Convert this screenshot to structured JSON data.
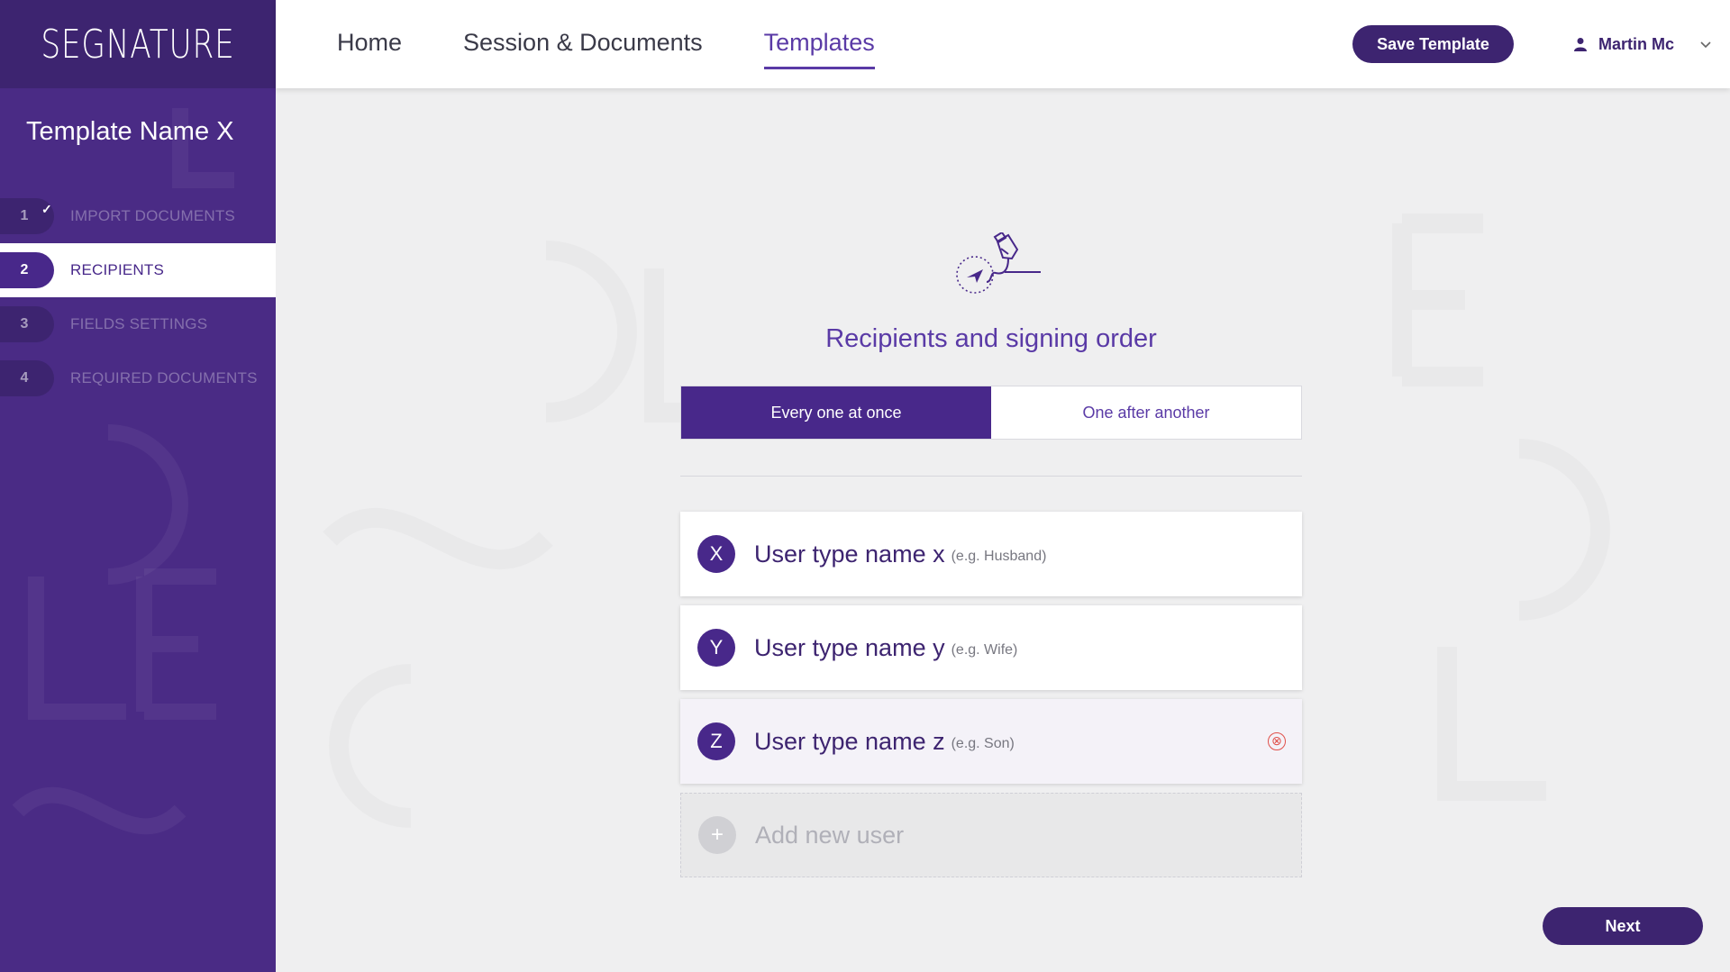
{
  "brand": {
    "logo_text": "SEGNATURE"
  },
  "header": {
    "nav": [
      {
        "label": "Home",
        "active": false
      },
      {
        "label": "Session & Documents",
        "active": false
      },
      {
        "label": "Templates",
        "active": true
      }
    ],
    "save_label": "Save Template",
    "user_name": "Martin Mc",
    "user_icon": "person-icon",
    "dropdown_icon": "chevron-down-icon"
  },
  "sidebar": {
    "template_name": "Template Name X",
    "steps": [
      {
        "number": "1",
        "label": "IMPORT DOCUMENTS",
        "completed": true,
        "check": "✓"
      },
      {
        "number": "2",
        "label": "RECIPIENTS",
        "active": true
      },
      {
        "number": "3",
        "label": "FIELDS SETTINGS"
      },
      {
        "number": "4",
        "label": "REQUIRED DOCUMENTS"
      }
    ]
  },
  "main": {
    "title": "Recipients and signing order",
    "hero_icon": "signing-pen-icon",
    "order_options": [
      {
        "label": "Every one at once",
        "active": true
      },
      {
        "label": "One after another",
        "active": false
      }
    ],
    "users": [
      {
        "letter": "X",
        "name": "User type name x",
        "hint": "(e.g. Husband)"
      },
      {
        "letter": "Y",
        "name": "User type name y",
        "hint": "(e.g. Wife)"
      },
      {
        "letter": "Z",
        "name": "User type name z",
        "hint": "(e.g. Son)",
        "remove_icon": "⊗"
      }
    ],
    "add_user": {
      "icon": "+",
      "label": "Add new user"
    },
    "next_label": "Next"
  },
  "colors": {
    "brand_purple": "#48288a",
    "dark_purple": "#3d2470",
    "accent": "#5a3aa6",
    "remove_red": "#e0504a",
    "background": "#efeff0"
  }
}
